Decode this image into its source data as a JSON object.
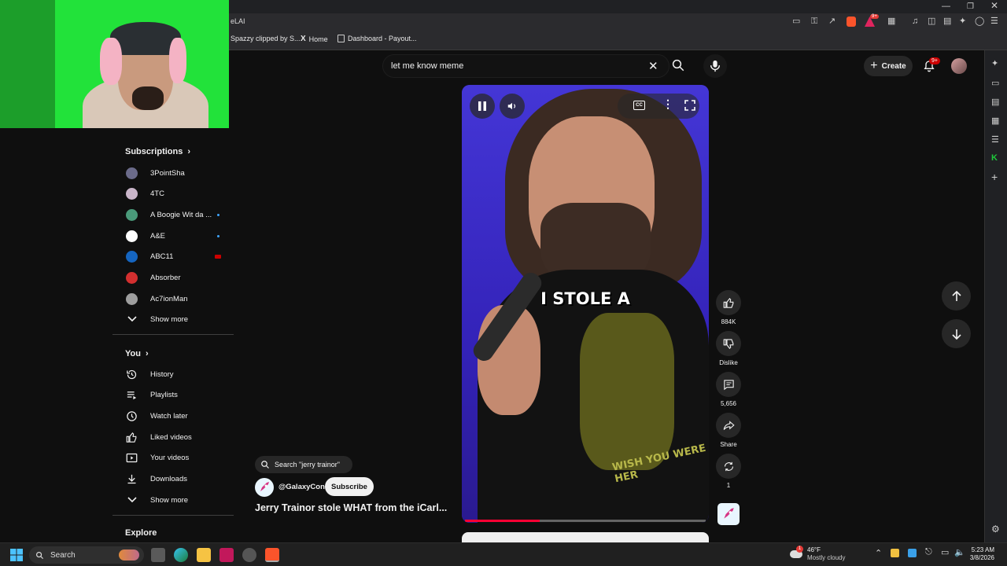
{
  "browser": {
    "tab_fragment": "eLAI",
    "bookmarks": [
      "Spazzy clipped by S...",
      "Home",
      "Dashboard - Payout..."
    ],
    "extension_badge": "9+"
  },
  "search": {
    "query": "let me know meme"
  },
  "header": {
    "create_label": "Create",
    "notification_badge": "9+"
  },
  "sidebar": {
    "subscriptions_title": "Subscriptions",
    "subscriptions": [
      {
        "label": "3PointSha",
        "color": "#6b6b8a",
        "indicator": "none"
      },
      {
        "label": "4TC",
        "color": "#c9b5c9",
        "indicator": "none"
      },
      {
        "label": "A Boogie Wit da ...",
        "color": "#4a9a7a",
        "indicator": "dot"
      },
      {
        "label": "A&E",
        "color": "#ffffff",
        "indicator": "dot"
      },
      {
        "label": "ABC11",
        "color": "#1565c0",
        "indicator": "live"
      },
      {
        "label": "Absorber",
        "color": "#d32f2f",
        "indicator": "none"
      },
      {
        "label": "Ac7ionMan",
        "color": "#9e9e9e",
        "indicator": "none"
      }
    ],
    "subs_show_more": "Show more",
    "you_title": "You",
    "you_items": [
      {
        "label": "History",
        "icon": "history-icon"
      },
      {
        "label": "Playlists",
        "icon": "playlists-icon"
      },
      {
        "label": "Watch later",
        "icon": "watch-later-icon"
      },
      {
        "label": "Liked videos",
        "icon": "like-icon"
      },
      {
        "label": "Your videos",
        "icon": "your-videos-icon"
      },
      {
        "label": "Downloads",
        "icon": "download-icon"
      }
    ],
    "you_show_more": "Show more",
    "explore_title": "Explore"
  },
  "short": {
    "caption": "I STOLE A",
    "shirt_text": "WISH YOU WERE HER",
    "search_chip": "Search \"jerry trainor\"",
    "channel": "@GalaxyCon",
    "subscribe_label": "Subscribe",
    "title": "Jerry Trainor stole WHAT from the iCarl...",
    "progress": 0.31
  },
  "actions": {
    "likes": "884K",
    "dislike_label": "Dislike",
    "comments": "5,656",
    "share_label": "Share",
    "remix_count": "1"
  },
  "taskbar": {
    "search_label": "Search",
    "weather_temp": "46°F",
    "weather_desc": "Mostly cloudy",
    "weather_badge": "1",
    "time": "5:23 AM",
    "date": "3/8/2026"
  }
}
